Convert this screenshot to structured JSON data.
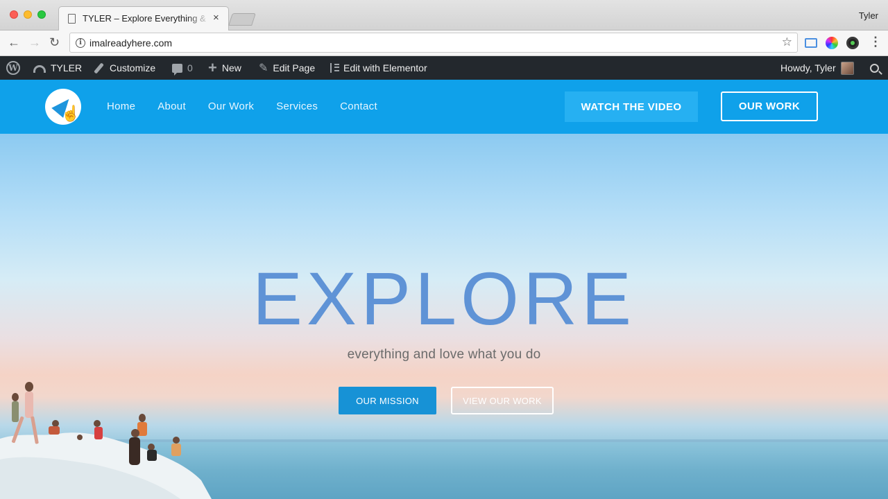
{
  "browser": {
    "tab_title": "TYLER – Explore Everything & L",
    "tab_close": "×",
    "profile_name": "Tyler",
    "url": "imalreadyhere.com",
    "back_glyph": "←",
    "forward_glyph": "→",
    "reload_glyph": "↻",
    "star_glyph": "☆",
    "menu_glyph": "⋮",
    "info_glyph": "i"
  },
  "adminbar": {
    "site_name": "TYLER",
    "customize": "Customize",
    "comments_count": "0",
    "new_label": "New",
    "edit_page": "Edit Page",
    "edit_elementor": "Edit with Elementor",
    "howdy": "Howdy, Tyler",
    "wp_glyph": "W",
    "plus_glyph": "+",
    "pencil_glyph": "✎"
  },
  "header": {
    "nav": [
      "Home",
      "About",
      "Our Work",
      "Services",
      "Contact"
    ],
    "watch_video": "WATCH THE VIDEO",
    "our_work": "OUR WORK",
    "cursor_glyph": "☝"
  },
  "hero": {
    "title": "EXPLORE",
    "subtitle": "everything and love what you do",
    "mission_button": "OUR MISSION",
    "view_button": "VIEW OUR WORK"
  },
  "colors": {
    "admin_bar": "#23282d",
    "header_blue": "#0fa1ea",
    "title_blue": "#5f93d6",
    "mission_blue": "#1792d6"
  }
}
